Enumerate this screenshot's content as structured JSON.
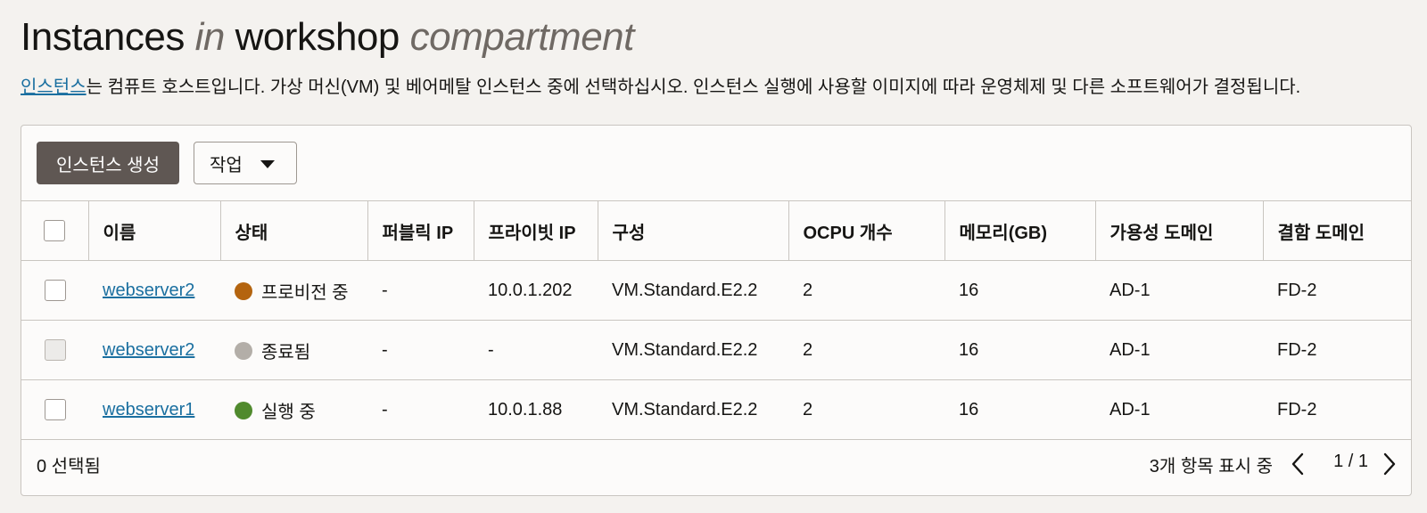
{
  "header": {
    "title_part1": "Instances",
    "title_in": "in",
    "title_compartment_name": "workshop",
    "title_compartment": "compartment"
  },
  "description": {
    "link_text": "인스턴스",
    "text": "는 컴퓨트 호스트입니다. 가상 머신(VM) 및 베어메탈 인스턴스 중에 선택하십시오. 인스턴스 실행에 사용할 이미지에 따라 운영체제 및 다른 소프트웨어가 결정됩니다."
  },
  "toolbar": {
    "create_label": "인스턴스 생성",
    "actions_label": "작업"
  },
  "table": {
    "columns": [
      "이름",
      "상태",
      "퍼블릭 IP",
      "프라이빗 IP",
      "구성",
      "OCPU 개수",
      "메모리(GB)",
      "가용성 도메인",
      "결함 도메인"
    ],
    "rows": [
      {
        "name": "webserver2",
        "status": "프로비전 중",
        "status_color": "#b4640f",
        "public_ip": "-",
        "private_ip": "10.0.1.202",
        "shape": "VM.Standard.E2.2",
        "ocpu": "2",
        "memory": "16",
        "ad": "AD-1",
        "fd": "FD-2",
        "checkbox_disabled": false
      },
      {
        "name": "webserver2",
        "status": "종료됨",
        "status_color": "#b3aea8",
        "public_ip": "-",
        "private_ip": "-",
        "shape": "VM.Standard.E2.2",
        "ocpu": "2",
        "memory": "16",
        "ad": "AD-1",
        "fd": "FD-2",
        "checkbox_disabled": true
      },
      {
        "name": "webserver1",
        "status": "실행 중",
        "status_color": "#508a2d",
        "public_ip": "-",
        "private_ip": "10.0.1.88",
        "shape": "VM.Standard.E2.2",
        "ocpu": "2",
        "memory": "16",
        "ad": "AD-1",
        "fd": "FD-2",
        "checkbox_disabled": false
      }
    ]
  },
  "footer": {
    "selected_text": "0 선택됨",
    "items_text": "3개 항목 표시 중",
    "page_text": "1 / 1"
  },
  "icons": {
    "prev": "chevron-left-icon",
    "next": "chevron-right-icon",
    "actions_caret": "caret-down-icon"
  }
}
